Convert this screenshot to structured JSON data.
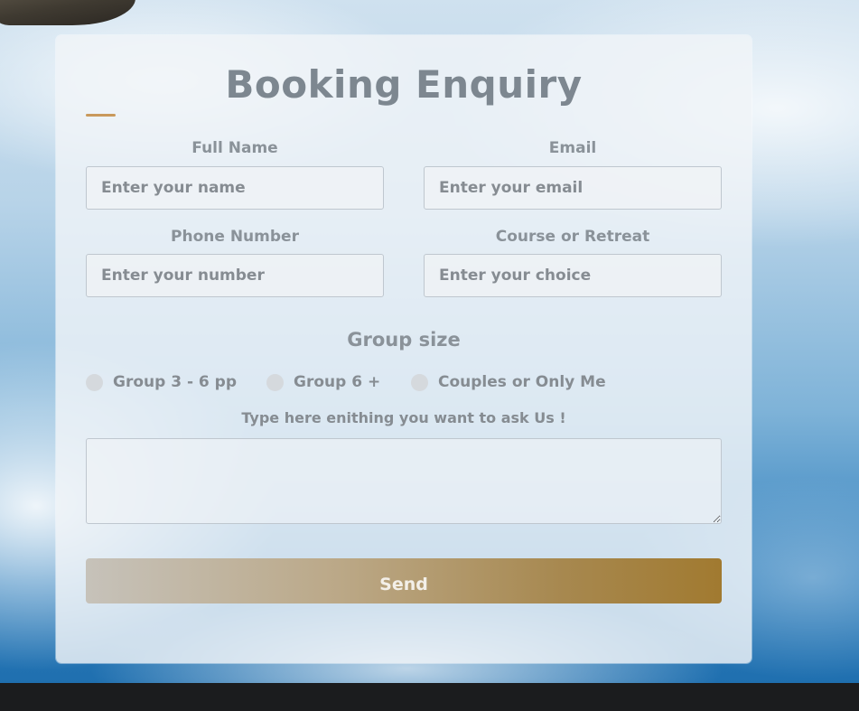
{
  "form": {
    "title": "Booking Enquiry",
    "full_name": {
      "label": "Full Name",
      "placeholder": "Enter your name"
    },
    "email": {
      "label": "Email",
      "placeholder": "Enter your email"
    },
    "phone": {
      "label": "Phone Number",
      "placeholder": "Enter your number"
    },
    "course": {
      "label": "Course or Retreat",
      "placeholder": "Enter your choice"
    },
    "group_size": {
      "title": "Group size",
      "options": [
        {
          "label": "Group 3 - 6 pp"
        },
        {
          "label": "Group 6 +"
        },
        {
          "label": "Couples or Only Me"
        }
      ]
    },
    "message": {
      "label": "Type here enithing you want to ask Us !",
      "value": ""
    },
    "send_label": "Send"
  },
  "colors": {
    "accent": "#c9995c",
    "button_gradient_end": "#a17a30",
    "text_gray": "#8a9299",
    "footer": "#1b1c1e"
  }
}
